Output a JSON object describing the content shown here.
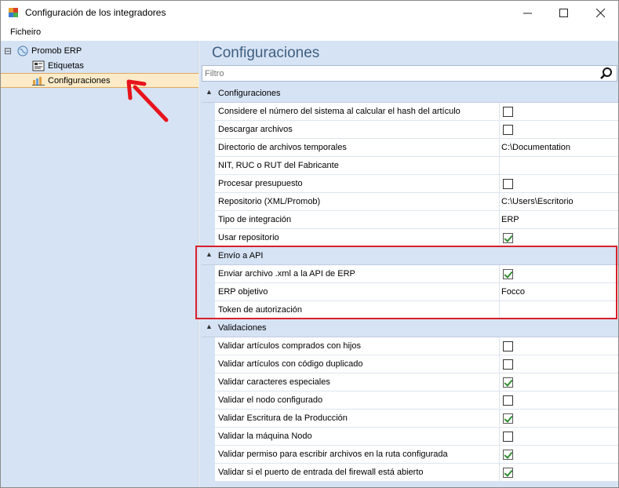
{
  "window": {
    "title": "Configuración de los integradores",
    "minimize_icon": "minimize-icon",
    "maximize_icon": "maximize-icon",
    "close_icon": "close-icon"
  },
  "menu": {
    "items": [
      "Ficheiro"
    ]
  },
  "tree": {
    "root": {
      "label": "Promob ERP",
      "expander": "⊟"
    },
    "children": [
      {
        "label": "Etiquetas",
        "icon": "label-icon"
      },
      {
        "label": "Configuraciones",
        "icon": "chart-icon"
      }
    ]
  },
  "main": {
    "title": "Configuraciones",
    "filter": {
      "placeholder": "Filtro",
      "value": ""
    }
  },
  "groups": [
    {
      "label": "Configuraciones",
      "chevron": "▲",
      "rows": [
        {
          "name": "Considere el número del sistema al calcular el hash del artículo",
          "type": "checkbox",
          "checked": false
        },
        {
          "name": "Descargar archivos",
          "type": "checkbox",
          "checked": false
        },
        {
          "name": "Directorio de archivos temporales",
          "type": "text",
          "value": "C:\\Documentation"
        },
        {
          "name": "NIT, RUC o RUT del Fabricante",
          "type": "text",
          "value": ""
        },
        {
          "name": "Procesar presupuesto",
          "type": "checkbox",
          "checked": false
        },
        {
          "name": "Repositorio (XML/Promob)",
          "type": "text",
          "value": "C:\\Users\\Escritorio"
        },
        {
          "name": "Tipo de integración",
          "type": "text",
          "value": "ERP"
        },
        {
          "name": "Usar repositorio",
          "type": "checkbox",
          "checked": true
        }
      ]
    },
    {
      "label": "Envío a API",
      "chevron": "▲",
      "rows": [
        {
          "name": "Enviar archivo .xml a la API de ERP",
          "type": "checkbox",
          "checked": true
        },
        {
          "name": "ERP objetivo",
          "type": "text",
          "value": "Focco"
        },
        {
          "name": "Token de autorización",
          "type": "text",
          "value": ""
        }
      ]
    },
    {
      "label": "Validaciones",
      "chevron": "▲",
      "rows": [
        {
          "name": "Validar artículos comprados con hijos",
          "type": "checkbox",
          "checked": false
        },
        {
          "name": "Validar artículos con código duplicado",
          "type": "checkbox",
          "checked": false
        },
        {
          "name": "Validar caracteres especiales",
          "type": "checkbox",
          "checked": true
        },
        {
          "name": "Validar el nodo configurado",
          "type": "checkbox",
          "checked": false
        },
        {
          "name": "Validar Escritura de la Producción",
          "type": "checkbox",
          "checked": true
        },
        {
          "name": "Validar la máquina Nodo",
          "type": "checkbox",
          "checked": false
        },
        {
          "name": "Validar permiso para escribir archivos en la ruta configurada",
          "type": "checkbox",
          "checked": true
        },
        {
          "name": "Validar si el puerto de entrada del firewall está abierto",
          "type": "checkbox",
          "checked": true
        }
      ]
    }
  ],
  "annotations": {
    "highlight_color": "#d9202a",
    "arrow_color": "#e8141c"
  }
}
